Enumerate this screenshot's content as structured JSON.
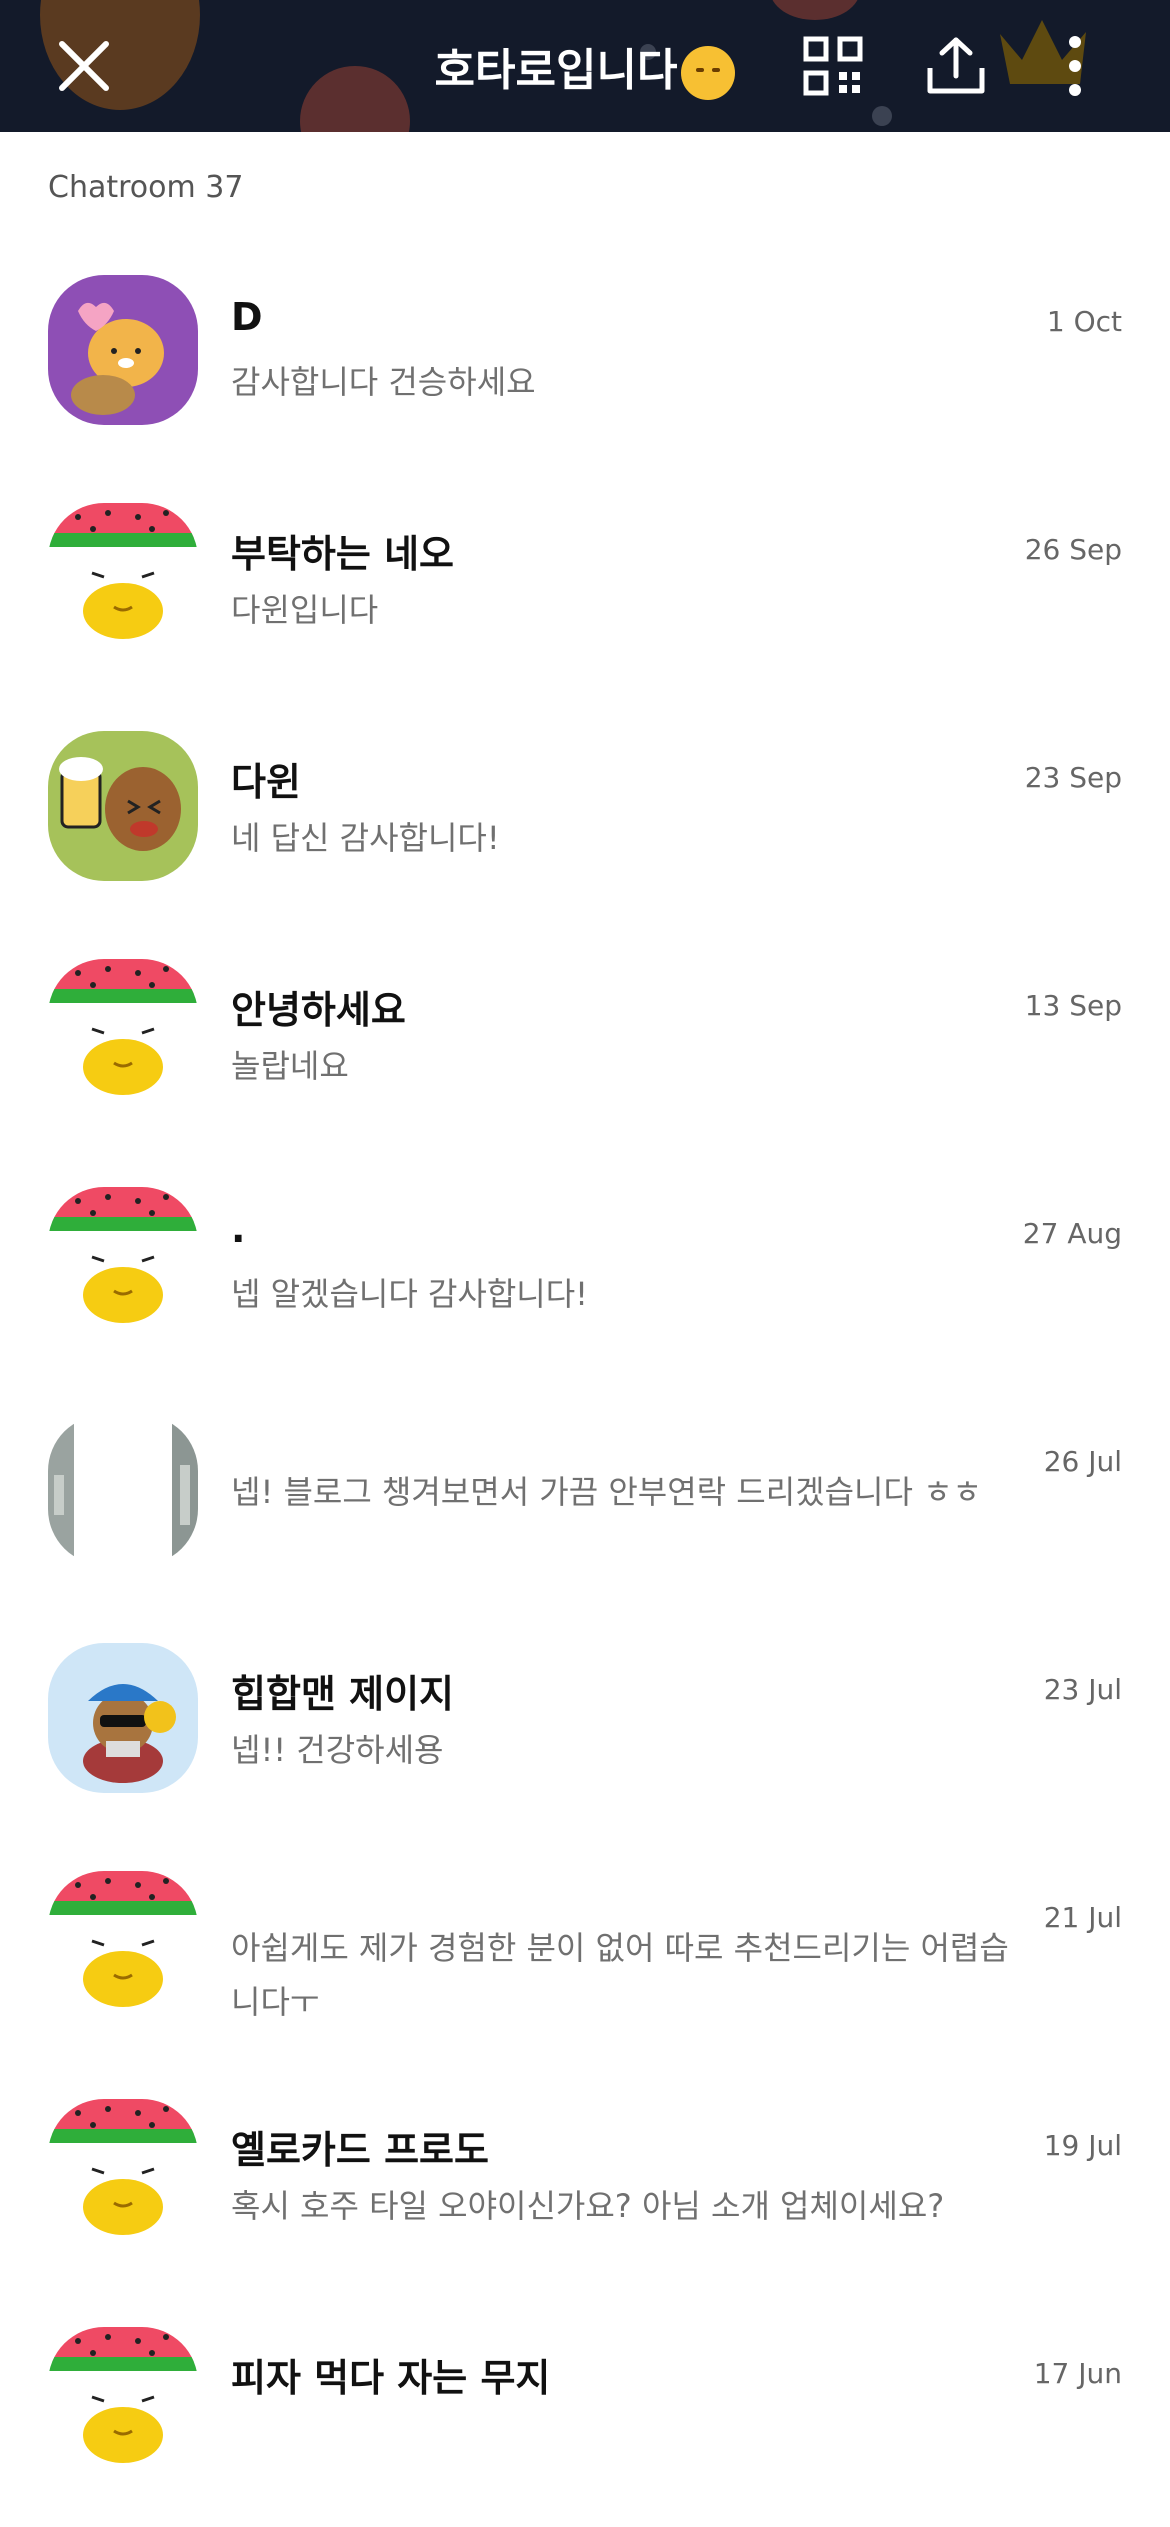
{
  "header": {
    "title": "호타로입니다",
    "emoji_icon": "upside-down-face-emoji",
    "icons": [
      "close-icon",
      "qr-code-icon",
      "share-icon",
      "more-vertical-icon"
    ],
    "background_color": "#131a2a"
  },
  "list_header": "Chatroom 37",
  "chats": [
    {
      "name": "D",
      "preview": "감사합니다 건승하세요",
      "time": "1 Oct",
      "avatar": "purple-bear"
    },
    {
      "name": "부탁하는 네오",
      "preview": "다윈입니다",
      "time": "26 Sep",
      "avatar": "watermelon"
    },
    {
      "name": "다윈",
      "preview": "네 답신 감사합니다!",
      "time": "23 Sep",
      "avatar": "beer-dog"
    },
    {
      "name": "안녕하세요",
      "preview": "놀랍네요",
      "time": "13 Sep",
      "avatar": "watermelon"
    },
    {
      "name": ".",
      "preview": "넵 알겠습니다 감사합니다!",
      "time": "27 Aug",
      "avatar": "watermelon"
    },
    {
      "name": "",
      "preview": "넵! 블로그 챙겨보면서 가끔 안부연락 드리겠습니다 ㅎㅎ",
      "time": "26 Jul",
      "avatar": "photo"
    },
    {
      "name": "힙합맨 제이지",
      "preview": "넵!! 건강하세용",
      "time": "23 Jul",
      "avatar": "hiphop"
    },
    {
      "name": "",
      "preview": "아쉽게도 제가 경험한 분이 없어 따로 추천드리기는 어렵습니다ㅜ",
      "time": "21 Jul",
      "avatar": "watermelon"
    },
    {
      "name": "옐로카드 프로도",
      "preview": "혹시 호주 타일 오야이신가요? 아님 소개 업체이세요?",
      "time": "19 Jul",
      "avatar": "watermelon"
    },
    {
      "name": "피자 먹다 자는 무지",
      "preview": "",
      "time": "17 Jun",
      "avatar": "watermelon"
    }
  ]
}
